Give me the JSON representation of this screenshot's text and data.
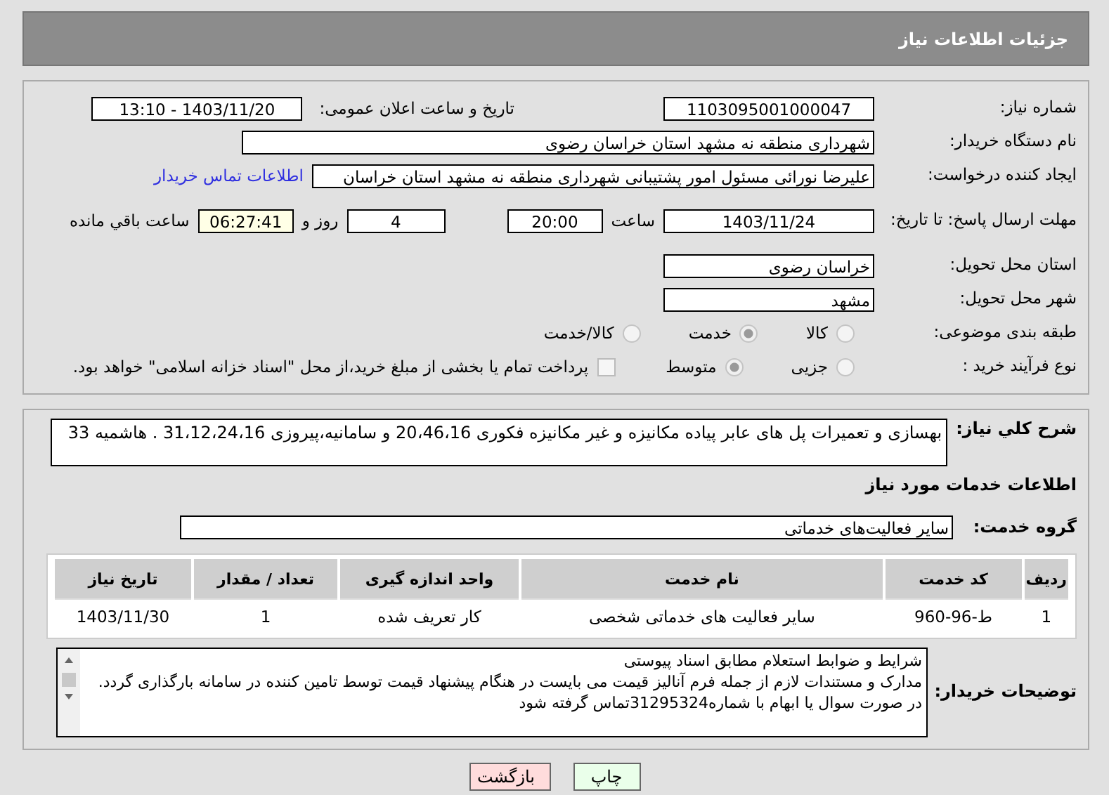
{
  "header": {
    "title": "جزئیات اطلاعات نیاز"
  },
  "details": {
    "need_number": {
      "label": "شماره نیاز:",
      "value": "1103095001000047"
    },
    "announce": {
      "label": "تاریخ و ساعت اعلان عمومی:",
      "value": "1403/11/20 - 13:10"
    },
    "buyer": {
      "label": "نام دستگاه خریدار:",
      "value": "شهرداری منطقه نه مشهد استان خراسان رضوی"
    },
    "creator": {
      "label": "ایجاد کننده درخواست:",
      "value": "علیرضا نورائی مسئول امور پشتیبانی شهرداری منطقه نه مشهد استان خراسان",
      "link": "اطلاعات تماس خریدار"
    },
    "deadline": {
      "label": "مهلت ارسال پاسخ: تا تاریخ:",
      "date": "1403/11/24",
      "time_label": "ساعت",
      "time": "20:00",
      "days": "4",
      "days_label": "روز و",
      "remaining": "06:27:41",
      "remaining_label": "ساعت باقي مانده"
    },
    "province": {
      "label": "استان محل تحویل:",
      "value": "خراسان رضوی"
    },
    "city": {
      "label": "شهر محل تحویل:",
      "value": "مشهد"
    },
    "category": {
      "label": "طبقه بندی موضوعی:",
      "options": [
        {
          "label": "کالا",
          "selected": false
        },
        {
          "label": "خدمت",
          "selected": true
        },
        {
          "label": "کالا/خدمت",
          "selected": false
        }
      ]
    },
    "purchase_type": {
      "label": "نوع فرآیند خرید :",
      "options": [
        {
          "label": "جزیی",
          "selected": false
        },
        {
          "label": "متوسط",
          "selected": true
        }
      ],
      "treasury": {
        "checked": false,
        "label": "پرداخت تمام یا بخشی از مبلغ خرید،از محل \"اسناد خزانه اسلامی\" خواهد بود."
      }
    }
  },
  "services": {
    "description": {
      "label": "شرح کلي نیاز:",
      "value": "بهسازی و تعمیرات پل های عابر پیاده مکانیزه و غیر مکانیزه فکوری 20،46،16 و سامانیه،پیروزی 31،12،24،16 . هاشمیه 33"
    },
    "heading": "اطلاعات خدمات مورد نیاز",
    "group": {
      "label": "گروه خدمت:",
      "value": "سایر فعالیت‌های خدماتی"
    },
    "table": {
      "columns": [
        "ردیف",
        "کد خدمت",
        "نام خدمت",
        "واحد اندازه گیری",
        "تعداد / مقدار",
        "تاریخ نیاز"
      ],
      "rows": [
        [
          "1",
          "ط-96-960",
          "سایر فعالیت های خدماتی شخصی",
          "کار تعریف شده",
          "1",
          "1403/11/30"
        ]
      ]
    },
    "notes": {
      "label": "توضیحات خریدار:",
      "lines": [
        "شرایط و ضوابط استعلام مطابق اسناد پیوستی",
        "مدارک و مستندات لازم از جمله فرم آنالیز قیمت می بایست در هنگام پیشنهاد قیمت توسط تامین کننده در سامانه بارگذاری گردد.",
        "در صورت سوال یا ابهام با شماره31295324تماس گرفته شود"
      ]
    }
  },
  "buttons": [
    {
      "kind": "print",
      "label": "چاپ"
    },
    {
      "kind": "back",
      "label": "بازگشت"
    }
  ]
}
